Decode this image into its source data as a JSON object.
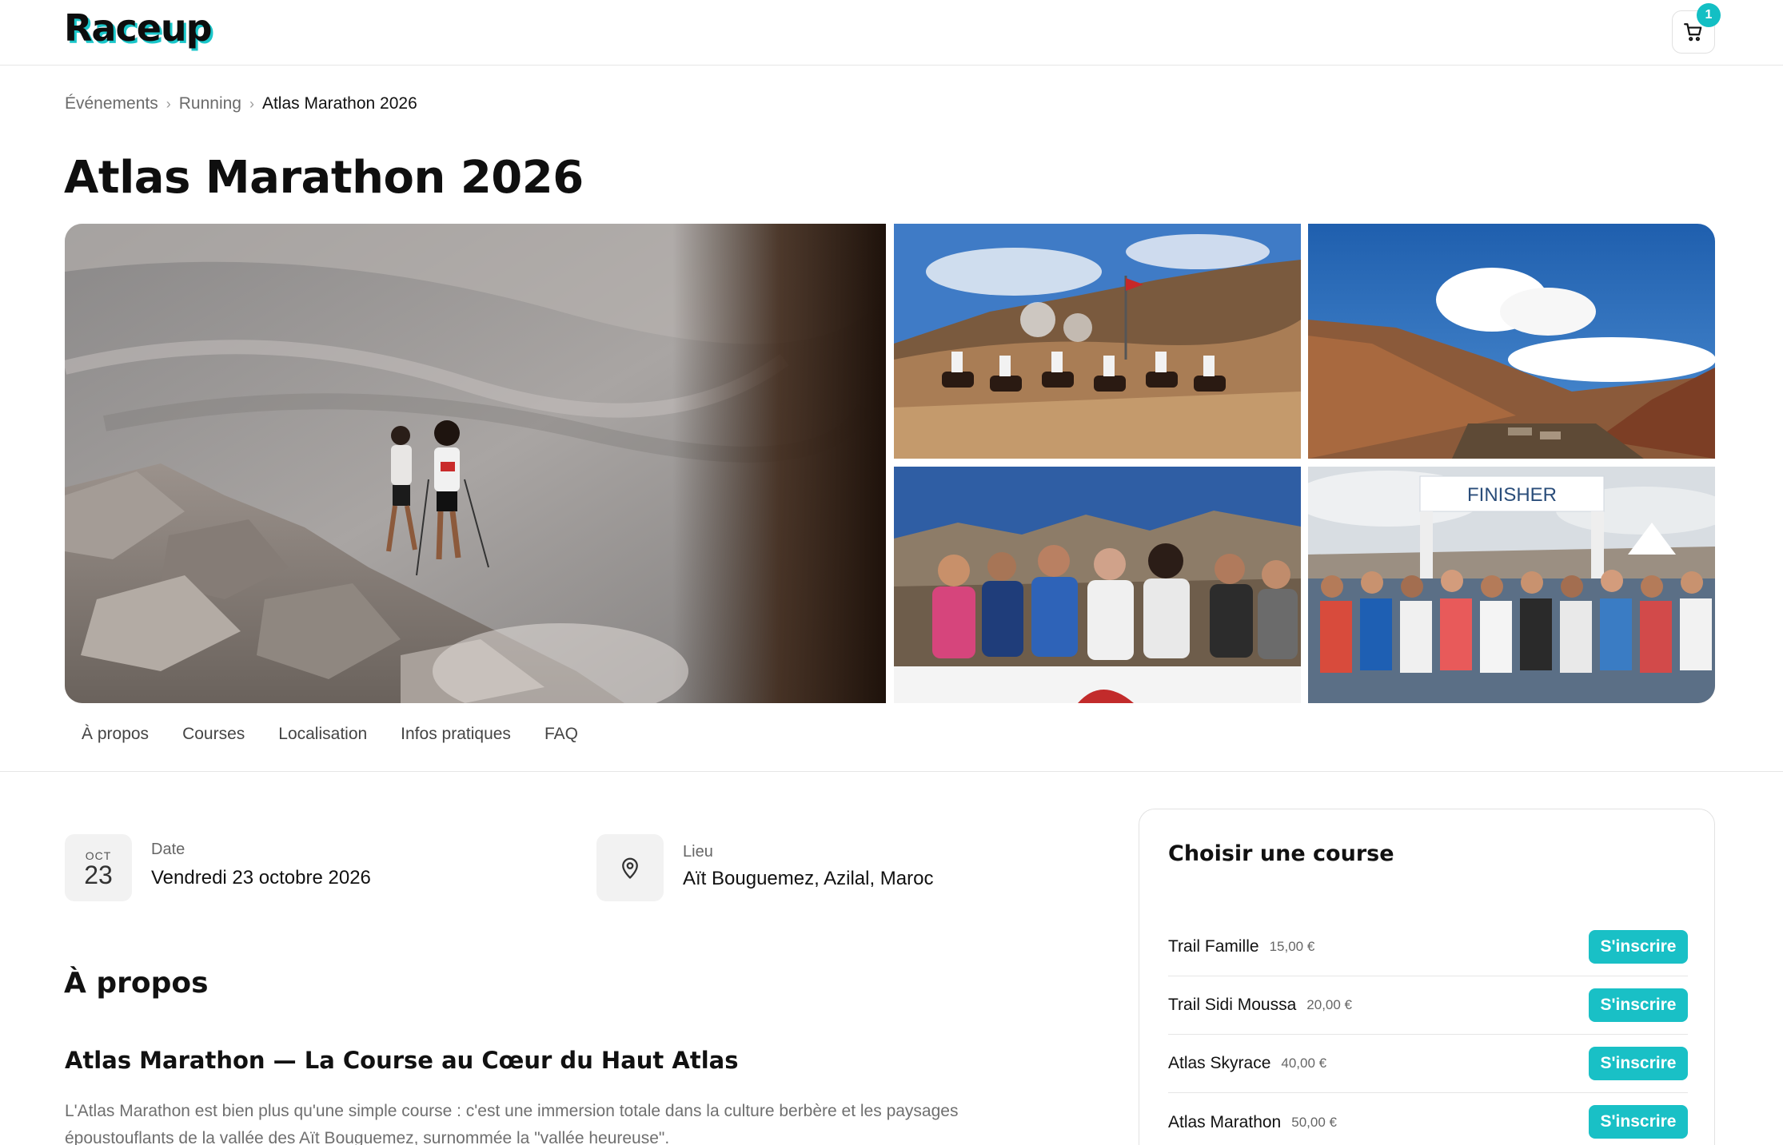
{
  "header": {
    "logo": "Raceup",
    "cart_count": "1"
  },
  "breadcrumb": [
    "Événements",
    "Running",
    "Atlas Marathon 2026"
  ],
  "title": "Atlas Marathon 2026",
  "gallery": {
    "finisher_banner": "FINISHER"
  },
  "tabs": [
    "À propos",
    "Courses",
    "Localisation",
    "Infos pratiques",
    "FAQ"
  ],
  "event": {
    "date_month": "OCT",
    "date_day": "23",
    "date_label": "Date",
    "date_value": "Vendredi 23 octobre 2026",
    "location_label": "Lieu",
    "location_value": "Aït Bouguemez, Azilal, Maroc"
  },
  "about": {
    "heading": "À propos",
    "subheading": "Atlas Marathon — La Course au Cœur du Haut Atlas",
    "text": "L'Atlas Marathon est bien plus qu'une simple course : c'est une immersion totale dans la culture berbère et les paysages époustouflants de la vallée des Aït Bouguemez, surnommée la \"vallée heureuse\"."
  },
  "panel": {
    "title": "Choisir une course",
    "button_label": "S'inscrire",
    "courses": [
      {
        "name": "Trail Famille",
        "price": "15,00 €"
      },
      {
        "name": "Trail Sidi Moussa",
        "price": "20,00 €"
      },
      {
        "name": "Atlas Skyrace",
        "price": "40,00 €"
      },
      {
        "name": "Atlas Marathon",
        "price": "50,00 €"
      }
    ]
  },
  "colors": {
    "accent": "#19c0c6",
    "text": "#111111",
    "muted": "#6f6f6f"
  }
}
